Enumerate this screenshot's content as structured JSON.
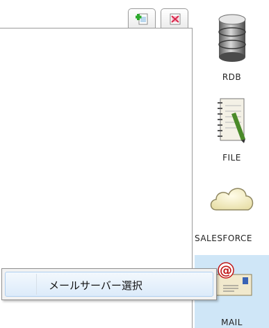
{
  "toolbar": {
    "add_icon": "add-page-icon",
    "delete_icon": "delete-page-icon"
  },
  "palette": {
    "items": [
      {
        "label": "RDB",
        "icon": "database-icon"
      },
      {
        "label": "FILE",
        "icon": "notebook-icon"
      },
      {
        "label": "SALESFORCE",
        "icon": "cloud-icon"
      },
      {
        "label": "MAIL",
        "icon": "mail-envelope-icon"
      }
    ],
    "selected_index": 3,
    "selected_color": "#cfe6f7"
  },
  "context_menu": {
    "items": [
      {
        "label": "メールサーバー選択"
      }
    ]
  }
}
